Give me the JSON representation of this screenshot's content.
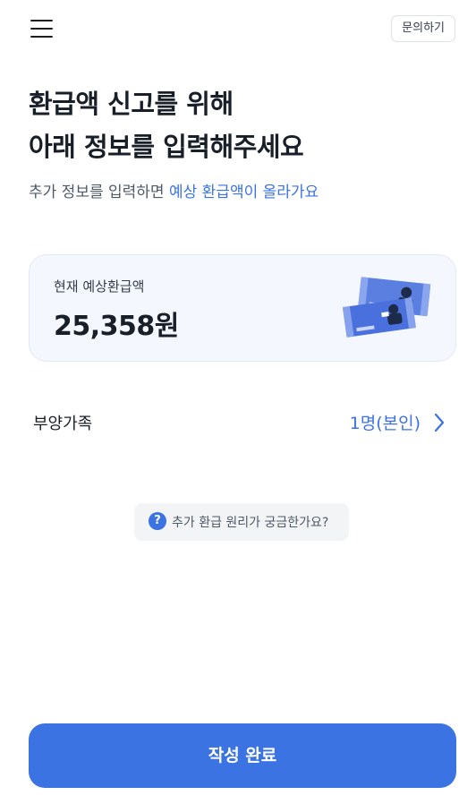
{
  "header": {
    "menu_icon": "hamburger-menu-icon",
    "contact_label": "문의하기"
  },
  "headline": {
    "line1": "환급액 신고를 위해",
    "line2": "아래 정보를 입력해주세요"
  },
  "subline": {
    "prefix": "추가 정보를 입력하면 ",
    "highlight": "예상 환급액이 올라가요"
  },
  "refund_card": {
    "label": "현재 예상환급액",
    "amount": "25,358원",
    "illustration_icon": "money-bills-illustration"
  },
  "dependents": {
    "label": "부양가족",
    "value": "1명(본인)",
    "chevron_icon": "chevron-right-icon"
  },
  "faq": {
    "icon": "?",
    "label": "추가 환급 원리가 궁금한가요?"
  },
  "submit": {
    "label": "작성 완료"
  },
  "colors": {
    "accent": "#3b73e3",
    "card_bg": "#f4f7fe",
    "chip_bg": "#f2f4f6",
    "text_primary": "#191f28",
    "text_secondary": "#4e5968"
  }
}
